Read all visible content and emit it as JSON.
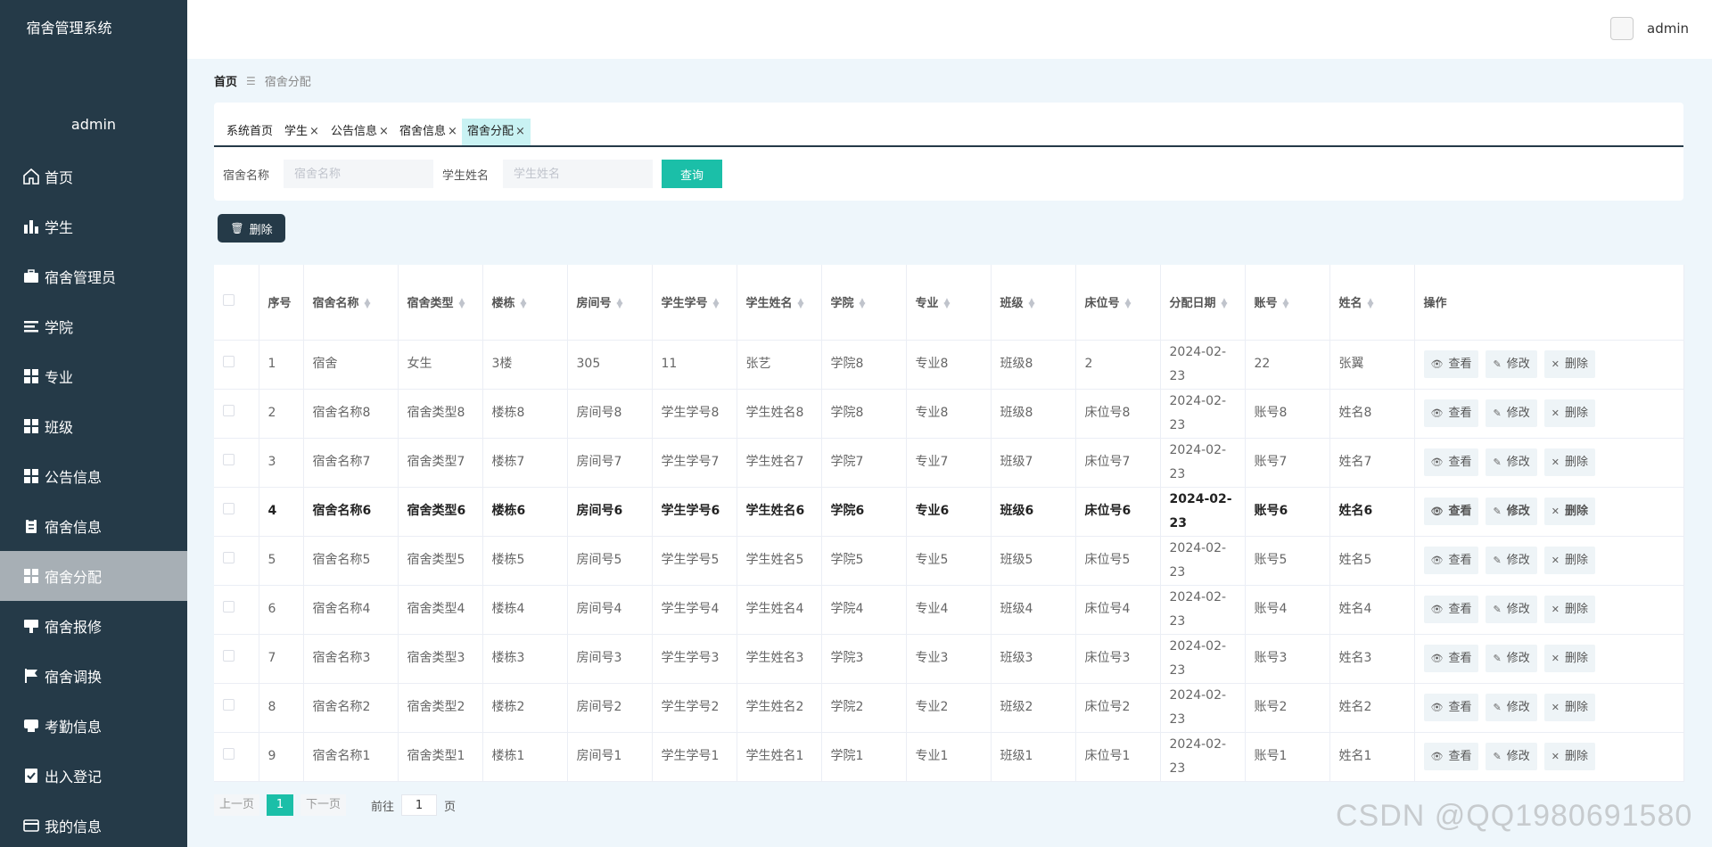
{
  "sidebar": {
    "title": "宿舍管理系统",
    "user": "admin",
    "items": [
      {
        "label": "首页",
        "icon": "home-icon"
      },
      {
        "label": "学生",
        "icon": "bar-chart-icon"
      },
      {
        "label": "宿舍管理员",
        "icon": "briefcase-icon"
      },
      {
        "label": "学院",
        "icon": "list-icon"
      },
      {
        "label": "专业",
        "icon": "grid-icon"
      },
      {
        "label": "班级",
        "icon": "grid-icon"
      },
      {
        "label": "公告信息",
        "icon": "grid-icon"
      },
      {
        "label": "宿舍信息",
        "icon": "clipboard-icon"
      },
      {
        "label": "宿舍分配",
        "icon": "grid-icon"
      },
      {
        "label": "宿舍报修",
        "icon": "board-icon"
      },
      {
        "label": "宿舍调换",
        "icon": "flag-icon"
      },
      {
        "label": "考勤信息",
        "icon": "stamp-icon"
      },
      {
        "label": "出入登记",
        "icon": "checklist-icon"
      },
      {
        "label": "我的信息",
        "icon": "card-icon"
      }
    ]
  },
  "header": {
    "user": "admin"
  },
  "breadcrumb": {
    "home": "首页",
    "separator": "☰",
    "current": "宿舍分配"
  },
  "tabs": [
    {
      "label": "系统首页",
      "closable": false
    },
    {
      "label": "学生",
      "closable": true
    },
    {
      "label": "公告信息",
      "closable": true
    },
    {
      "label": "宿舍信息",
      "closable": true
    },
    {
      "label": "宿舍分配",
      "closable": true
    }
  ],
  "search": {
    "dorm_label": "宿舍名称",
    "dorm_placeholder": "宿舍名称",
    "student_label": "学生姓名",
    "student_placeholder": "学生姓名",
    "query_button": "查询"
  },
  "delete_all_label": "删除",
  "table": {
    "columns": [
      "序号",
      "宿舍名称",
      "宿舍类型",
      "楼栋",
      "房间号",
      "学生学号",
      "学生姓名",
      "学院",
      "专业",
      "班级",
      "床位号",
      "分配日期",
      "账号",
      "姓名",
      "操作"
    ],
    "rows": [
      [
        "1",
        "宿舍",
        "女生",
        "3楼",
        "305",
        "11",
        "张艺",
        "学院8",
        "专业8",
        "班级8",
        "2",
        "2024-02-23",
        "22",
        "张翼"
      ],
      [
        "2",
        "宿舍名称8",
        "宿舍类型8",
        "楼栋8",
        "房间号8",
        "学生学号8",
        "学生姓名8",
        "学院8",
        "专业8",
        "班级8",
        "床位号8",
        "2024-02-23",
        "账号8",
        "姓名8"
      ],
      [
        "3",
        "宿舍名称7",
        "宿舍类型7",
        "楼栋7",
        "房间号7",
        "学生学号7",
        "学生姓名7",
        "学院7",
        "专业7",
        "班级7",
        "床位号7",
        "2024-02-23",
        "账号7",
        "姓名7"
      ],
      [
        "4",
        "宿舍名称6",
        "宿舍类型6",
        "楼栋6",
        "房间号6",
        "学生学号6",
        "学生姓名6",
        "学院6",
        "专业6",
        "班级6",
        "床位号6",
        "2024-02-23",
        "账号6",
        "姓名6"
      ],
      [
        "5",
        "宿舍名称5",
        "宿舍类型5",
        "楼栋5",
        "房间号5",
        "学生学号5",
        "学生姓名5",
        "学院5",
        "专业5",
        "班级5",
        "床位号5",
        "2024-02-23",
        "账号5",
        "姓名5"
      ],
      [
        "6",
        "宿舍名称4",
        "宿舍类型4",
        "楼栋4",
        "房间号4",
        "学生学号4",
        "学生姓名4",
        "学院4",
        "专业4",
        "班级4",
        "床位号4",
        "2024-02-23",
        "账号4",
        "姓名4"
      ],
      [
        "7",
        "宿舍名称3",
        "宿舍类型3",
        "楼栋3",
        "房间号3",
        "学生学号3",
        "学生姓名3",
        "学院3",
        "专业3",
        "班级3",
        "床位号3",
        "2024-02-23",
        "账号3",
        "姓名3"
      ],
      [
        "8",
        "宿舍名称2",
        "宿舍类型2",
        "楼栋2",
        "房间号2",
        "学生学号2",
        "学生姓名2",
        "学院2",
        "专业2",
        "班级2",
        "床位号2",
        "2024-02-23",
        "账号2",
        "姓名2"
      ],
      [
        "9",
        "宿舍名称1",
        "宿舍类型1",
        "楼栋1",
        "房间号1",
        "学生学号1",
        "学生姓名1",
        "学院1",
        "专业1",
        "班级1",
        "床位号1",
        "2024-02-23",
        "账号1",
        "姓名1"
      ]
    ],
    "highlighted_row": 3,
    "actions": {
      "view": "查看",
      "edit": "修改",
      "delete": "删除"
    }
  },
  "pagination": {
    "prev": "上一页",
    "current": "1",
    "next": "下一页",
    "goto": "前往",
    "page_input": "1",
    "unit": "页"
  },
  "watermark": "CSDN @QQ1980691580",
  "colors": {
    "sidebar": "#253a48",
    "accent": "#1bbfa8",
    "active_menu": "#a7afb5",
    "active_tab": "#c9f2f3"
  }
}
